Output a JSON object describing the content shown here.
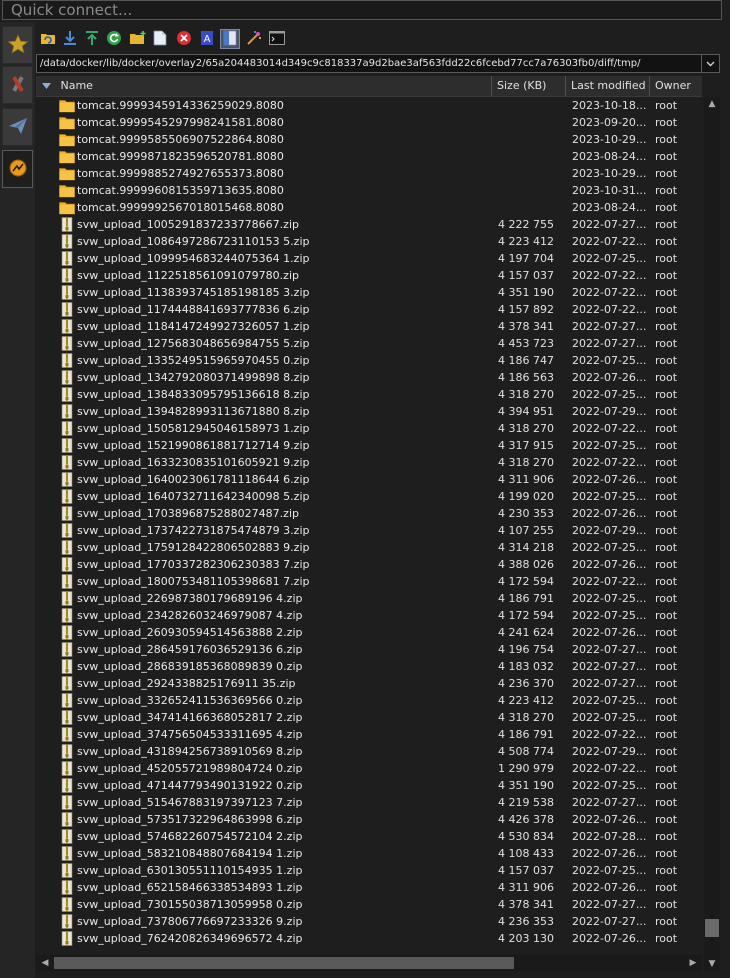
{
  "quick_connect": {
    "placeholder": "Quick connect..."
  },
  "sidebar": {
    "tabs": [
      "star-icon",
      "tools-icon",
      "send-icon",
      "connected-icon"
    ]
  },
  "toolbar": {
    "buttons": [
      "refresh-icon",
      "download-icon",
      "upload-icon",
      "sync-icon",
      "new-folder-icon",
      "new-file-icon",
      "delete-icon",
      "rename-icon",
      "view-icon",
      "wand-icon",
      "terminal-icon"
    ]
  },
  "path": {
    "value": "/data/docker/lib/docker/overlay2/65a204483014d349c9c818337a9d2bae3af563fdd22c6fcebd77cc7a76303fb0/diff/tmp/"
  },
  "columns": {
    "name": "Name",
    "size": "Size (KB)",
    "modified": "Last modified",
    "owner": "Owner"
  },
  "files": [
    {
      "type": "folder",
      "name": "tomcat.9999345914336259029.8080",
      "size": "",
      "modified": "2023-10-18...",
      "owner": "root"
    },
    {
      "type": "folder",
      "name": "tomcat.9999545297998241581.8080",
      "size": "",
      "modified": "2023-09-20...",
      "owner": "root"
    },
    {
      "type": "folder",
      "name": "tomcat.9999585506907522864.8080",
      "size": "",
      "modified": "2023-10-29...",
      "owner": "root"
    },
    {
      "type": "folder",
      "name": "tomcat.9999871823596520781.8080",
      "size": "",
      "modified": "2023-08-24...",
      "owner": "root"
    },
    {
      "type": "folder",
      "name": "tomcat.9999885274927655373.8080",
      "size": "",
      "modified": "2023-10-29...",
      "owner": "root"
    },
    {
      "type": "folder",
      "name": "tomcat.9999960815359713635.8080",
      "size": "",
      "modified": "2023-10-31...",
      "owner": "root"
    },
    {
      "type": "folder",
      "name": "tomcat.9999992567018015468.8080",
      "size": "",
      "modified": "2023-08-24...",
      "owner": "root"
    },
    {
      "type": "zip",
      "name": "svw_upload_1005291837233778667.zip",
      "size": "4 222 755",
      "modified": "2022-07-27...",
      "owner": "root"
    },
    {
      "type": "zip",
      "name": "svw_upload_1086497286723110153 5.zip",
      "size": "4 223 412",
      "modified": "2022-07-22...",
      "owner": "root"
    },
    {
      "type": "zip",
      "name": "svw_upload_1099954683244075364 1.zip",
      "size": "4 197 704",
      "modified": "2022-07-25...",
      "owner": "root"
    },
    {
      "type": "zip",
      "name": "svw_upload_1122518561091079780.zip",
      "size": "4 157 037",
      "modified": "2022-07-22...",
      "owner": "root"
    },
    {
      "type": "zip",
      "name": "svw_upload_1138393745185198185 3.zip",
      "size": "4 351 190",
      "modified": "2022-07-22...",
      "owner": "root"
    },
    {
      "type": "zip",
      "name": "svw_upload_1174448841693777836 6.zip",
      "size": "4 157 892",
      "modified": "2022-07-22...",
      "owner": "root"
    },
    {
      "type": "zip",
      "name": "svw_upload_1184147249927326057 1.zip",
      "size": "4 378 341",
      "modified": "2022-07-27...",
      "owner": "root"
    },
    {
      "type": "zip",
      "name": "svw_upload_1275683048656984755 5.zip",
      "size": "4 453 723",
      "modified": "2022-07-27...",
      "owner": "root"
    },
    {
      "type": "zip",
      "name": "svw_upload_1335249515965970455 0.zip",
      "size": "4 186 747",
      "modified": "2022-07-25...",
      "owner": "root"
    },
    {
      "type": "zip",
      "name": "svw_upload_1342792080371499898 8.zip",
      "size": "4 186 563",
      "modified": "2022-07-26...",
      "owner": "root"
    },
    {
      "type": "zip",
      "name": "svw_upload_1384833095795136618 8.zip",
      "size": "4 318 270",
      "modified": "2022-07-25...",
      "owner": "root"
    },
    {
      "type": "zip",
      "name": "svw_upload_1394828993113671880 8.zip",
      "size": "4 394 951",
      "modified": "2022-07-29...",
      "owner": "root"
    },
    {
      "type": "zip",
      "name": "svw_upload_1505812945046158973 1.zip",
      "size": "4 318 270",
      "modified": "2022-07-22...",
      "owner": "root"
    },
    {
      "type": "zip",
      "name": "svw_upload_1521990861881712714 9.zip",
      "size": "4 317 915",
      "modified": "2022-07-25...",
      "owner": "root"
    },
    {
      "type": "zip",
      "name": "svw_upload_1633230835101605921 9.zip",
      "size": "4 318 270",
      "modified": "2022-07-22...",
      "owner": "root"
    },
    {
      "type": "zip",
      "name": "svw_upload_1640023061781118644 6.zip",
      "size": "4 311 906",
      "modified": "2022-07-26...",
      "owner": "root"
    },
    {
      "type": "zip",
      "name": "svw_upload_1640732711642340098 5.zip",
      "size": "4 199 020",
      "modified": "2022-07-25...",
      "owner": "root"
    },
    {
      "type": "zip",
      "name": "svw_upload_1703896875288027487.zip",
      "size": "4 230 353",
      "modified": "2022-07-26...",
      "owner": "root"
    },
    {
      "type": "zip",
      "name": "svw_upload_1737422731875474879 3.zip",
      "size": "4 107 255",
      "modified": "2022-07-29...",
      "owner": "root"
    },
    {
      "type": "zip",
      "name": "svw_upload_1759128422806502883 9.zip",
      "size": "4 314 218",
      "modified": "2022-07-25...",
      "owner": "root"
    },
    {
      "type": "zip",
      "name": "svw_upload_1770337282306230383 7.zip",
      "size": "4 388 026",
      "modified": "2022-07-26...",
      "owner": "root"
    },
    {
      "type": "zip",
      "name": "svw_upload_1800753481105398681 7.zip",
      "size": "4 172 594",
      "modified": "2022-07-22...",
      "owner": "root"
    },
    {
      "type": "zip",
      "name": "svw_upload_226987380179689196 4.zip",
      "size": "4 186 791",
      "modified": "2022-07-25...",
      "owner": "root"
    },
    {
      "type": "zip",
      "name": "svw_upload_234282603246979087 4.zip",
      "size": "4 172 594",
      "modified": "2022-07-25...",
      "owner": "root"
    },
    {
      "type": "zip",
      "name": "svw_upload_260930594514563888 2.zip",
      "size": "4 241 624",
      "modified": "2022-07-26...",
      "owner": "root"
    },
    {
      "type": "zip",
      "name": "svw_upload_286459176036529136 6.zip",
      "size": "4 196 754",
      "modified": "2022-07-27...",
      "owner": "root"
    },
    {
      "type": "zip",
      "name": "svw_upload_286839185368089839 0.zip",
      "size": "4 183 032",
      "modified": "2022-07-27...",
      "owner": "root"
    },
    {
      "type": "zip",
      "name": "svw_upload_2924338825176911 35.zip",
      "size": "4 236 370",
      "modified": "2022-07-27...",
      "owner": "root"
    },
    {
      "type": "zip",
      "name": "svw_upload_332652411536369566 0.zip",
      "size": "4 223 412",
      "modified": "2022-07-25...",
      "owner": "root"
    },
    {
      "type": "zip",
      "name": "svw_upload_347414166368052817 2.zip",
      "size": "4 318 270",
      "modified": "2022-07-25...",
      "owner": "root"
    },
    {
      "type": "zip",
      "name": "svw_upload_374756504533311695 4.zip",
      "size": "4 186 791",
      "modified": "2022-07-22...",
      "owner": "root"
    },
    {
      "type": "zip",
      "name": "svw_upload_431894256738910569 8.zip",
      "size": "4 508 774",
      "modified": "2022-07-29...",
      "owner": "root"
    },
    {
      "type": "zip",
      "name": "svw_upload_452055721989804724 0.zip",
      "size": "1 290 979",
      "modified": "2022-07-22...",
      "owner": "root"
    },
    {
      "type": "zip",
      "name": "svw_upload_471447793490131922 0.zip",
      "size": "4 351 190",
      "modified": "2022-07-25...",
      "owner": "root"
    },
    {
      "type": "zip",
      "name": "svw_upload_515467883197397123 7.zip",
      "size": "4 219 538",
      "modified": "2022-07-27...",
      "owner": "root"
    },
    {
      "type": "zip",
      "name": "svw_upload_573517322964863998 6.zip",
      "size": "4 426 378",
      "modified": "2022-07-26...",
      "owner": "root"
    },
    {
      "type": "zip",
      "name": "svw_upload_574682260754572104 2.zip",
      "size": "4 530 834",
      "modified": "2022-07-28...",
      "owner": "root"
    },
    {
      "type": "zip",
      "name": "svw_upload_583210848807684194 1.zip",
      "size": "4 108 433",
      "modified": "2022-07-26...",
      "owner": "root"
    },
    {
      "type": "zip",
      "name": "svw_upload_630130551110154935 1.zip",
      "size": "4 157 037",
      "modified": "2022-07-25...",
      "owner": "root"
    },
    {
      "type": "zip",
      "name": "svw_upload_652158466338534893 1.zip",
      "size": "4 311 906",
      "modified": "2022-07-26...",
      "owner": "root"
    },
    {
      "type": "zip",
      "name": "svw_upload_730155038713059958 0.zip",
      "size": "4 378 341",
      "modified": "2022-07-27...",
      "owner": "root"
    },
    {
      "type": "zip",
      "name": "svw_upload_737806776697233326 9.zip",
      "size": "4 236 353",
      "modified": "2022-07-27...",
      "owner": "root"
    },
    {
      "type": "zip",
      "name": "svw_upload_762420826349696572 4.zip",
      "size": "4 203 130",
      "modified": "2022-07-26...",
      "owner": "root"
    }
  ],
  "colors": {
    "folder": "#f0b429",
    "accent": "#4a5668"
  }
}
